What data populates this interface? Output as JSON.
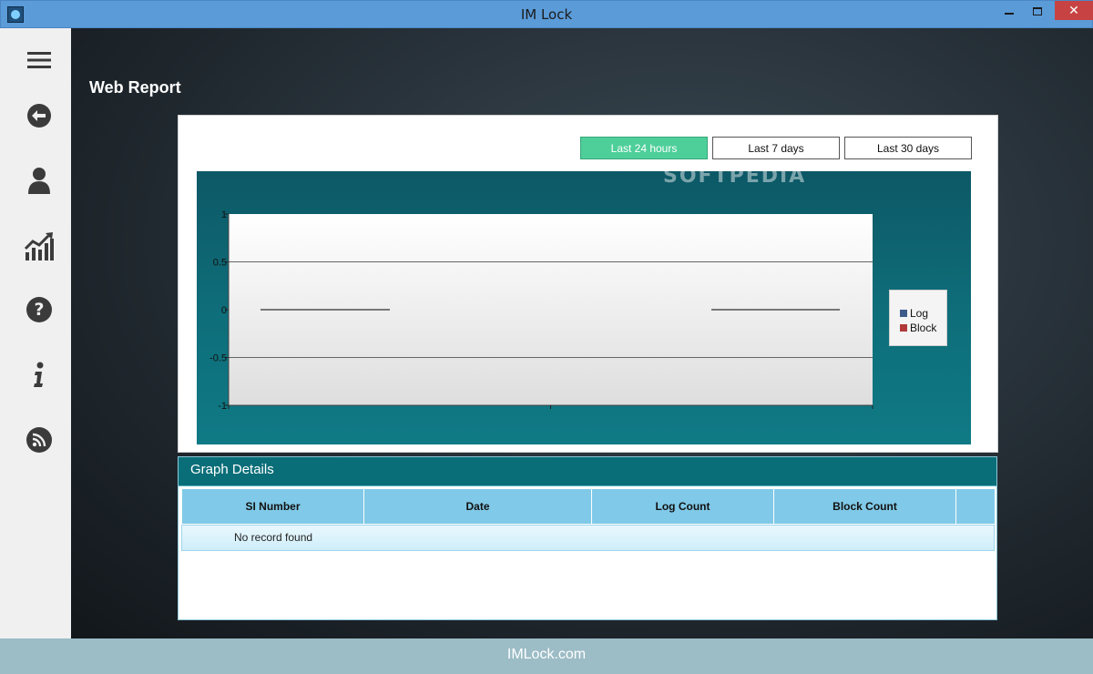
{
  "window": {
    "title": "IM Lock"
  },
  "sidebar": {
    "items": [
      {
        "name": "menu-icon"
      },
      {
        "name": "back-arrow-icon"
      },
      {
        "name": "user-icon"
      },
      {
        "name": "chart-trend-icon"
      },
      {
        "name": "help-icon"
      },
      {
        "name": "info-icon"
      },
      {
        "name": "rss-icon"
      }
    ]
  },
  "page": {
    "title": "Web Report"
  },
  "ranges": [
    {
      "label": "Last 24 hours",
      "active": true
    },
    {
      "label": "Last 7 days",
      "active": false
    },
    {
      "label": "Last 30 days",
      "active": false
    }
  ],
  "watermark": "SOFTPEDIA",
  "chart_data": {
    "type": "line",
    "ylim": [
      -1,
      1
    ],
    "yticks": [
      "1",
      "0.5",
      "0",
      "-0.5",
      "-1"
    ],
    "grid": true,
    "legend_position": "right",
    "series": [
      {
        "name": "Log",
        "color": "#3d5a8a",
        "values": [
          0,
          0
        ]
      },
      {
        "name": "Block",
        "color": "#b03a3a",
        "values": [
          0,
          0
        ]
      }
    ]
  },
  "details": {
    "title": "Graph Details",
    "columns": [
      "SI Number",
      "Date",
      "Log Count",
      "Block Count"
    ],
    "empty_message": "No record found"
  },
  "footer": {
    "text": "IMLock.com"
  }
}
